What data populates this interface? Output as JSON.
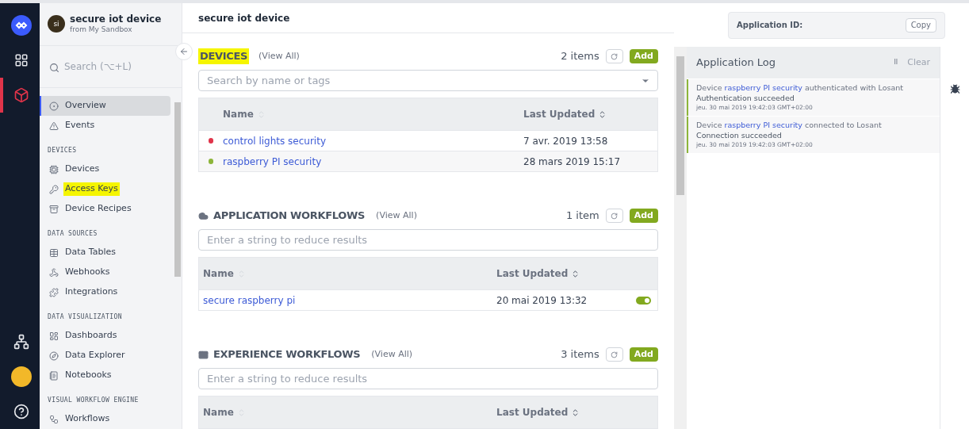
{
  "rail": [
    {
      "kind": "logo",
      "selected": false
    },
    {
      "kind": "dashboard",
      "selected": false
    },
    {
      "kind": "app",
      "selected": true
    },
    {
      "kind": "hub",
      "selected": false
    },
    {
      "kind": "avatar",
      "selected": false
    },
    {
      "kind": "help",
      "selected": false
    }
  ],
  "sidebar": {
    "app_name": "secure iot device",
    "app_initials": "si",
    "app_source": "from My Sandbox",
    "search_placeholder": "Search (⌥+L)",
    "groups": [
      {
        "items": [
          {
            "label": "Overview",
            "selected": true,
            "highlighted": false
          },
          {
            "label": "Events",
            "selected": false,
            "highlighted": false
          }
        ]
      },
      {
        "heading": "DEVICES",
        "items": [
          {
            "label": "Devices",
            "selected": false,
            "highlighted": false
          },
          {
            "label": "Access Keys",
            "selected": false,
            "highlighted": true
          },
          {
            "label": "Device Recipes",
            "selected": false,
            "highlighted": false
          }
        ]
      },
      {
        "heading": "DATA SOURCES",
        "items": [
          {
            "label": "Data Tables",
            "selected": false,
            "highlighted": false
          },
          {
            "label": "Webhooks",
            "selected": false,
            "highlighted": false
          },
          {
            "label": "Integrations",
            "selected": false,
            "highlighted": false
          }
        ]
      },
      {
        "heading": "DATA VISUALIZATION",
        "items": [
          {
            "label": "Dashboards",
            "selected": false,
            "highlighted": false
          },
          {
            "label": "Data Explorer",
            "selected": false,
            "highlighted": false
          },
          {
            "label": "Notebooks",
            "selected": false,
            "highlighted": false
          }
        ]
      },
      {
        "heading": "VISUAL WORKFLOW ENGINE",
        "items": [
          {
            "label": "Workflows",
            "selected": false,
            "highlighted": false
          }
        ]
      }
    ]
  },
  "main": {
    "title": "secure iot device",
    "sections": [
      {
        "kind": "devices",
        "title": "DEVICES",
        "highlighted": true,
        "view_all": "(View All)",
        "count": "2 items",
        "add": "Add",
        "search_placeholder": "Search by name or tags",
        "columns": [
          "Name",
          "Last Updated"
        ],
        "rows": [
          {
            "name": "control lights security",
            "updated": "7 avr. 2019 13:58",
            "color": "#e0344a"
          },
          {
            "name": "raspberry PI security",
            "updated": "28 mars 2019 15:17",
            "color": "#8db53a"
          }
        ]
      },
      {
        "kind": "application",
        "title": "APPLICATION WORKFLOWS",
        "highlighted": false,
        "view_all": "(View All)",
        "count": "1 item",
        "add": "Add",
        "search_placeholder": "Enter a string to reduce results",
        "columns": [
          "Name",
          "Last Updated"
        ],
        "rows": [
          {
            "name": "secure raspberry pi",
            "updated": "20 mai 2019 13:32",
            "on": true
          }
        ]
      },
      {
        "kind": "experience",
        "title": "EXPERIENCE WORKFLOWS",
        "highlighted": false,
        "view_all": "(View All)",
        "count": "3 items",
        "add": "Add",
        "search_placeholder": "Enter a string to reduce results",
        "columns": [
          "Name",
          "Last Updated"
        ]
      }
    ]
  },
  "app_id": {
    "label": "Application ID:",
    "copy": "Copy"
  },
  "log": {
    "title": "Application Log",
    "pause": "II",
    "clear": "Clear",
    "entries": [
      {
        "prefix": "Device",
        "device": "raspberry PI security",
        "suffix": "authenticated with Losant",
        "message": "Authentication succeeded",
        "time": "jeu. 30 mai 2019 19:42:03 GMT+02:00"
      },
      {
        "prefix": "Device",
        "device": "raspberry PI security",
        "suffix": "connected to Losant",
        "message": "Connection succeeded",
        "time": "jeu. 30 mai 2019 19:42:03 GMT+02:00"
      }
    ]
  }
}
